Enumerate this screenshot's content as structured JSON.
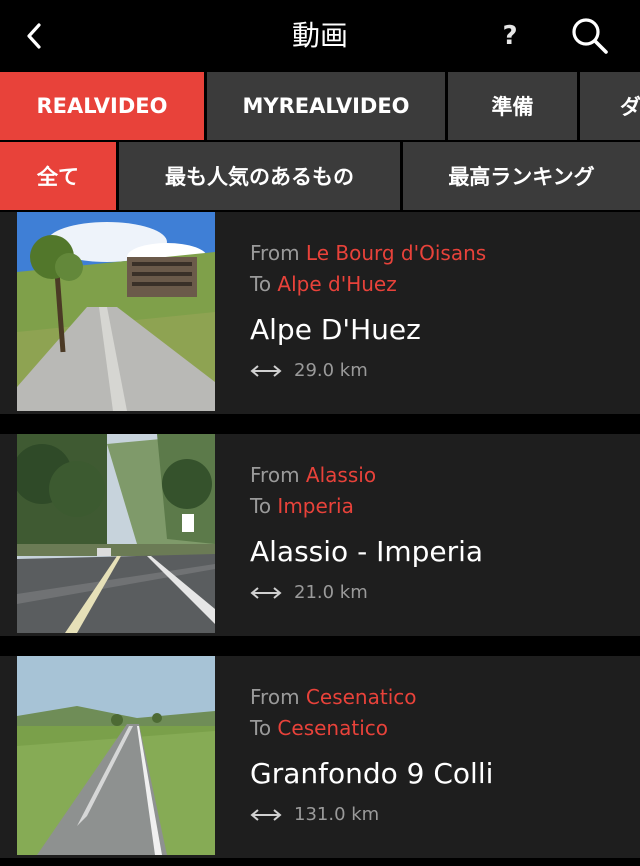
{
  "header": {
    "title": "動画",
    "back_icon": "chevron-left-icon",
    "help_label": "?",
    "search_icon": "search-icon"
  },
  "tabs": [
    {
      "label": "REALVIDEO",
      "active": true
    },
    {
      "label": "MYREALVIDEO",
      "active": false
    },
    {
      "label": "準備",
      "active": false
    },
    {
      "label": "ダ",
      "active": false
    }
  ],
  "filters": [
    {
      "label": "全て",
      "active": true
    },
    {
      "label": "最も人気のあるもの",
      "active": false
    },
    {
      "label": "最高ランキング",
      "active": false
    }
  ],
  "videos": [
    {
      "from_label": "From",
      "from": "Le Bourg d'Oisans",
      "to_label": "To",
      "to": "Alpe d'Huez",
      "name": "Alpe D'Huez",
      "distance": "29.0 km",
      "distance_icon": "double-arrow-icon"
    },
    {
      "from_label": "From",
      "from": "Alassio",
      "to_label": "To",
      "to": "Imperia",
      "name": "Alassio - Imperia",
      "distance": "21.0 km",
      "distance_icon": "double-arrow-icon"
    },
    {
      "from_label": "From",
      "from": "Cesenatico",
      "to_label": "To",
      "to": "Cesenatico",
      "name": "Granfondo 9 Colli",
      "distance": "131.0 km",
      "distance_icon": "double-arrow-icon"
    }
  ],
  "colors": {
    "accent": "#e8423a",
    "tab_bg": "#3b3b3b",
    "card_bg": "#1e1e1e",
    "muted_text": "#9a9a9a"
  }
}
